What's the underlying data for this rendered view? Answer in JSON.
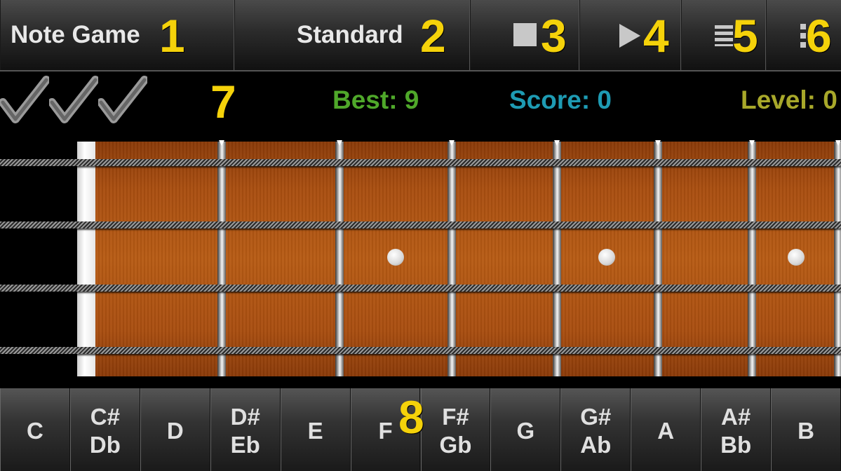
{
  "toolbar": {
    "mode_label": "Note Game",
    "tuning_label": "Standard",
    "stop_icon": "stop-icon",
    "play_icon": "play-icon",
    "list_icon": "list-icon",
    "menu_icon": "overflow-menu-icon"
  },
  "annotations": [
    "1",
    "2",
    "3",
    "4",
    "5",
    "6",
    "7",
    "8"
  ],
  "status": {
    "best": "Best: 9",
    "score": "Score: 0",
    "level": "Level: 0",
    "best_color": "#4fa82a",
    "score_color": "#1e9bb3",
    "level_color": "#a8a82a"
  },
  "keys": [
    {
      "lines": [
        "C"
      ]
    },
    {
      "lines": [
        "C#",
        "Db"
      ]
    },
    {
      "lines": [
        "D"
      ]
    },
    {
      "lines": [
        "D#",
        "Eb"
      ]
    },
    {
      "lines": [
        "E"
      ]
    },
    {
      "lines": [
        "F"
      ]
    },
    {
      "lines": [
        "F#",
        "Gb"
      ]
    },
    {
      "lines": [
        "G"
      ]
    },
    {
      "lines": [
        "G#",
        "Ab"
      ]
    },
    {
      "lines": [
        "A"
      ]
    },
    {
      "lines": [
        "A#",
        "Bb"
      ]
    },
    {
      "lines": [
        "B"
      ]
    }
  ]
}
